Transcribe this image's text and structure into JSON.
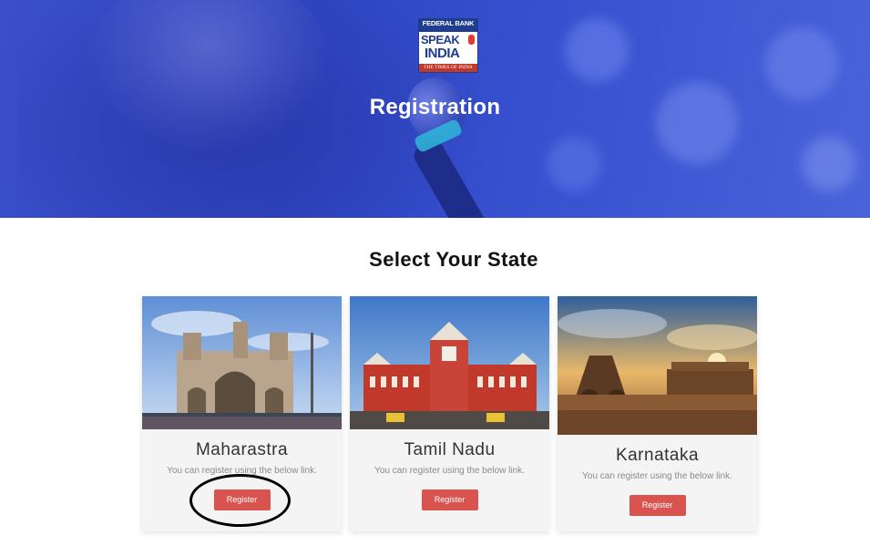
{
  "hero": {
    "logo": {
      "bank": "FEDERAL BANK",
      "speak": "SPEAK",
      "india": "INDIA",
      "newspaper": "THE TIMES OF INDIA"
    },
    "title": "Registration"
  },
  "section": {
    "title": "Select Your State"
  },
  "states": [
    {
      "name": "Maharastra",
      "description": "You can register using the below link.",
      "button": "Register",
      "photo": "gateway-of-india-image"
    },
    {
      "name": "Tamil Nadu",
      "description": "You can register using the below link.",
      "button": "Register",
      "photo": "chennai-central-station-image"
    },
    {
      "name": "Karnataka",
      "description": "You can register using the below link.",
      "button": "Register",
      "photo": "hampi-stone-chariot-image"
    }
  ],
  "colors": {
    "hero_blue": "#3a4fc9",
    "button_red": "#d9534f",
    "card_bg": "#f4f4f4"
  }
}
